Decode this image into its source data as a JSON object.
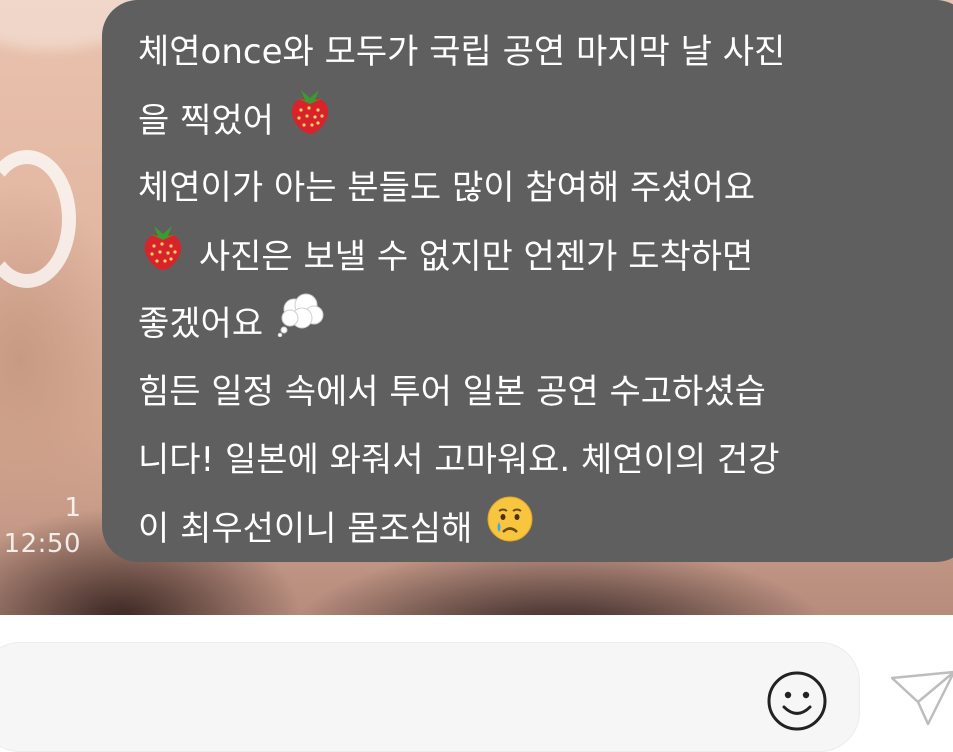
{
  "message": {
    "read_count": "1",
    "time": "12:50",
    "lines": [
      {
        "text": "체연once와 모두가 국립 공연 마지막 날 사진",
        "emoji_before": "",
        "emoji_after": ""
      },
      {
        "text": "을 찍었어",
        "emoji_before": "",
        "emoji_after": "strawberry-icon"
      },
      {
        "text": "체연이가 아는 분들도 많이 참여해 주셨어요",
        "emoji_before": "",
        "emoji_after": ""
      },
      {
        "text": " 사진은 보낼 수 없지만 언젠가 도착하면",
        "emoji_before": "strawberry-icon",
        "emoji_after": ""
      },
      {
        "text": "좋겠어요",
        "emoji_before": "",
        "emoji_after": "thought-balloon-icon"
      },
      {
        "text": "힘든 일정 속에서 투어 일본 공연 수고하셨습",
        "emoji_before": "",
        "emoji_after": ""
      },
      {
        "text": "니다! 일본에 와줘서 고마워요. 체연이의 건강",
        "emoji_before": "",
        "emoji_after": ""
      },
      {
        "text": "이 최우선이니 몸조심해",
        "emoji_before": "",
        "emoji_after": "crying-face-icon"
      }
    ]
  },
  "composer": {
    "placeholder": "",
    "emoji_button": "smiley-face-icon",
    "send_button": "paper-plane-icon"
  },
  "colors": {
    "bubble": "#5f5f5f",
    "bubble_text": "#ffffff",
    "input_bg": "#f6f6f6"
  }
}
